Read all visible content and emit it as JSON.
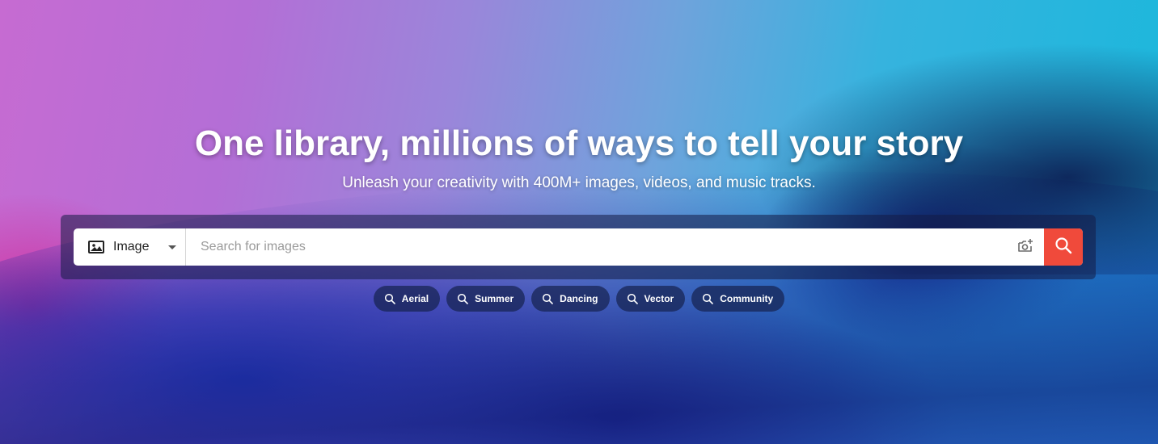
{
  "hero": {
    "title": "One library, millions of ways to tell your story",
    "subtitle": "Unleash your creativity with 400M+ images, videos, and music tracks."
  },
  "search": {
    "type_label": "Image",
    "type_icon": "image-icon",
    "placeholder": "Search for images",
    "value": "",
    "camera_icon": "camera-plus-icon",
    "submit_icon": "search-icon",
    "submit_color": "#f04a3b"
  },
  "chips": [
    {
      "label": "Aerial",
      "icon": "search-icon"
    },
    {
      "label": "Summer",
      "icon": "search-icon"
    },
    {
      "label": "Dancing",
      "icon": "search-icon"
    },
    {
      "label": "Vector",
      "icon": "search-icon"
    },
    {
      "label": "Community",
      "icon": "search-icon"
    }
  ]
}
